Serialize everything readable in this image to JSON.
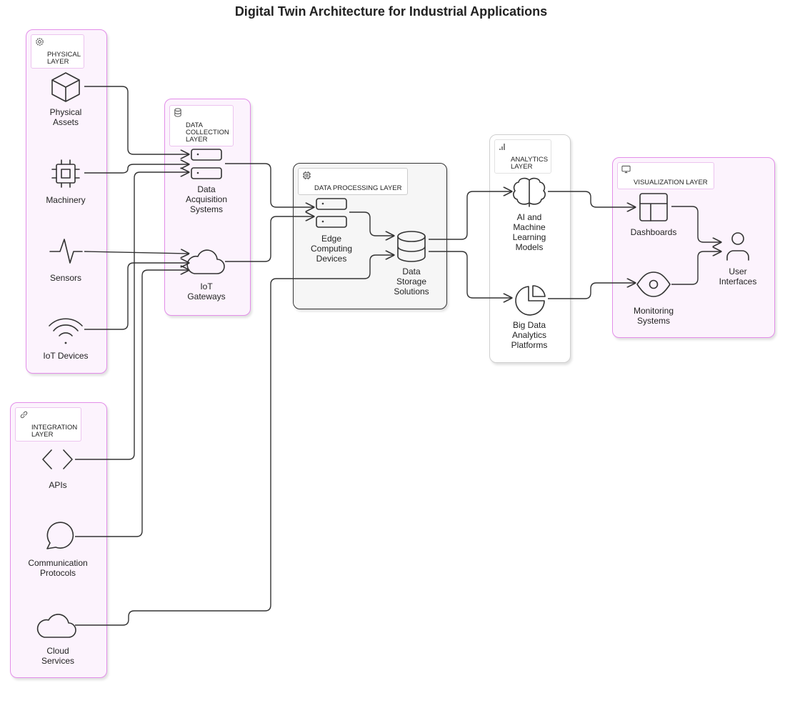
{
  "title": "Digital Twin Architecture for Industrial Applications",
  "colors": {
    "pink_border": "#e38ee9",
    "pink_fill": "#fcf3fd",
    "line": "#333333"
  },
  "groups": {
    "physical": {
      "label": "PHYSICAL\nLAYER",
      "icon": "gear-icon"
    },
    "collection": {
      "label": "DATA\nCOLLECTION\nLAYER",
      "icon": "database-icon"
    },
    "processing": {
      "label": "DATA PROCESSING LAYER",
      "icon": "chip-icon"
    },
    "analytics": {
      "label": "ANALYTICS\nLAYER",
      "icon": "bar-chart-icon"
    },
    "visualization": {
      "label": "VISUALIZATION LAYER",
      "icon": "monitor-icon"
    },
    "integration": {
      "label": "INTEGRATION\nLAYER",
      "icon": "link-icon"
    }
  },
  "nodes": {
    "assets": {
      "label": "Physical\nAssets",
      "icon": "cube-icon"
    },
    "machinery": {
      "label": "Machinery",
      "icon": "cpu-icon"
    },
    "sensors": {
      "label": "Sensors",
      "icon": "pulse-icon"
    },
    "iotdev": {
      "label": "IoT Devices",
      "icon": "wifi-icon"
    },
    "das": {
      "label": "Data\nAcquisition\nSystems",
      "icon": "server-icon"
    },
    "gateways": {
      "label": "IoT\nGateways",
      "icon": "cloud-icon"
    },
    "edge": {
      "label": "Edge\nComputing\nDevices",
      "icon": "server-icon"
    },
    "storage": {
      "label": "Data\nStorage\nSolutions",
      "icon": "database-icon"
    },
    "ai": {
      "label": "AI and\nMachine\nLearning\nModels",
      "icon": "brain-icon"
    },
    "bigdata": {
      "label": "Big Data\nAnalytics\nPlatforms",
      "icon": "pie-chart-icon"
    },
    "dash": {
      "label": "Dashboards",
      "icon": "layout-icon"
    },
    "monitor": {
      "label": "Monitoring\nSystems",
      "icon": "eye-icon"
    },
    "ui": {
      "label": "User\nInterfaces",
      "icon": "user-icon"
    },
    "apis": {
      "label": "APIs",
      "icon": "code-icon"
    },
    "comm": {
      "label": "Communication\nProtocols",
      "icon": "chat-bubble-icon"
    },
    "cloud": {
      "label": "Cloud\nServices",
      "icon": "cloud-icon"
    }
  },
  "edges": [
    [
      "assets",
      "das"
    ],
    [
      "machinery",
      "das"
    ],
    [
      "apis",
      "das"
    ],
    [
      "sensors",
      "gateways"
    ],
    [
      "iotdev",
      "gateways"
    ],
    [
      "comm",
      "gateways"
    ],
    [
      "das",
      "edge"
    ],
    [
      "gateways",
      "edge"
    ],
    [
      "edge",
      "storage"
    ],
    [
      "cloud",
      "storage"
    ],
    [
      "storage",
      "ai"
    ],
    [
      "storage",
      "bigdata"
    ],
    [
      "ai",
      "dash"
    ],
    [
      "bigdata",
      "monitor"
    ],
    [
      "dash",
      "ui"
    ],
    [
      "monitor",
      "ui"
    ]
  ]
}
